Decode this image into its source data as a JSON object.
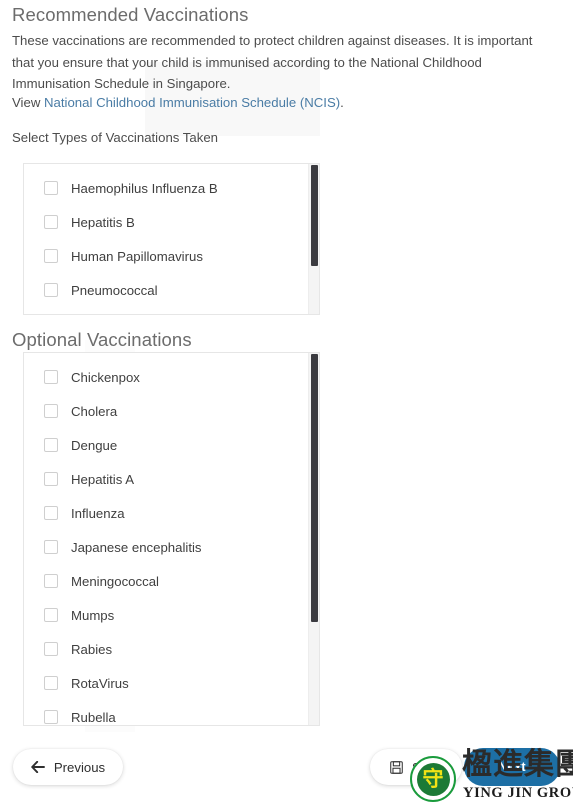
{
  "recommended": {
    "title": "Recommended Vaccinations",
    "description": "These vaccinations are recommended to protect children against diseases. It is important that you ensure that your child is immunised according to the National Childhood Immunisation Schedule in Singapore.",
    "view_prefix": "View ",
    "link_text": "National Childhood Immunisation Schedule (NCIS)",
    "view_suffix": ".",
    "select_label": "Select Types of Vaccinations Taken",
    "items": [
      {
        "label": "Haemophilus Influenza B",
        "checked": false
      },
      {
        "label": "Hepatitis B",
        "checked": false
      },
      {
        "label": "Human Papillomavirus",
        "checked": false
      },
      {
        "label": "Pneumococcal",
        "checked": false
      },
      {
        "label": "",
        "checked": false
      }
    ]
  },
  "optional": {
    "title": "Optional Vaccinations",
    "items": [
      {
        "label": "Chickenpox",
        "checked": false
      },
      {
        "label": "Cholera",
        "checked": false
      },
      {
        "label": "Dengue",
        "checked": false
      },
      {
        "label": "Hepatitis A",
        "checked": false
      },
      {
        "label": "Influenza",
        "checked": false
      },
      {
        "label": "Japanese encephalitis",
        "checked": false
      },
      {
        "label": "Meningococcal",
        "checked": false
      },
      {
        "label": "Mumps",
        "checked": false
      },
      {
        "label": "Rabies",
        "checked": false
      },
      {
        "label": "RotaVirus",
        "checked": false
      },
      {
        "label": "Rubella",
        "checked": false
      }
    ]
  },
  "footer": {
    "previous_label": "Previous",
    "previous_icon": "arrow-left-icon",
    "save_label": "Save",
    "save_icon": "floppy-disk-icon",
    "next_label": "Next"
  },
  "watermark": {
    "chinese": "楹進集團",
    "english": "YING JIN GROUP",
    "seal_glyph": "守"
  },
  "colors": {
    "link": "#4a7ca5",
    "heading": "#6c6c6c",
    "body_text": "#4c4c4c",
    "next_button": "#1d6fa5",
    "scrollbar_thumb": "#3b3b40",
    "scrollbar_track": "#f4f4f4",
    "checkbox_border": "#cfcfcf",
    "listbox_border": "#e6e6e6",
    "watermark_green": "#1a9b3c",
    "watermark_yellow": "#f2e316"
  }
}
